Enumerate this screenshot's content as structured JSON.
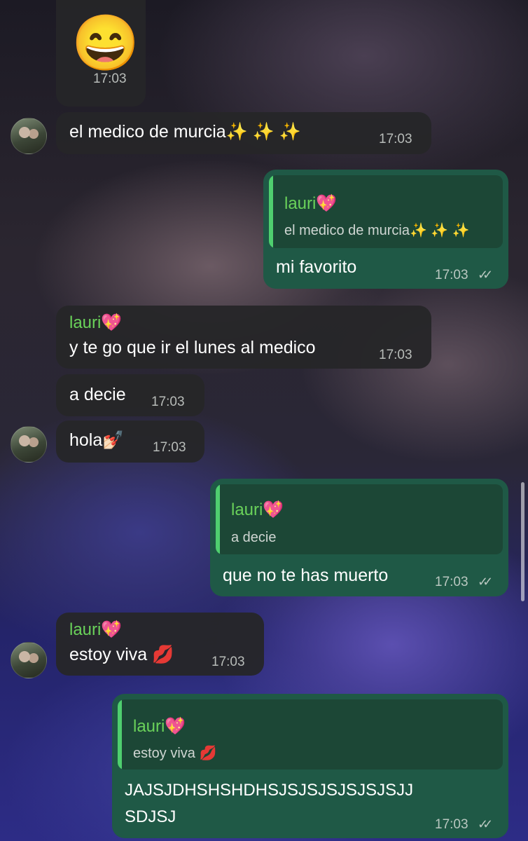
{
  "messages": {
    "m1": {
      "emoji": "😄",
      "time": "17:03"
    },
    "m2": {
      "text": "el medico de murcia✨ ✨ ✨",
      "time": "17:03"
    },
    "m3": {
      "quote_sender": "lauri💖",
      "quote_text": "el medico de murcia✨ ✨ ✨",
      "text": "mi favorito",
      "time": "17:03",
      "ticks": "✓✓"
    },
    "m4": {
      "sender": "lauri💖",
      "text": "y te go que ir el lunes al medico",
      "time": "17:03"
    },
    "m5": {
      "text": "a decie",
      "time": "17:03"
    },
    "m6": {
      "text": "hola💅🏻",
      "time": "17:03"
    },
    "m7": {
      "quote_sender": "lauri💖",
      "quote_text": "a decie",
      "text": "que no te has muerto",
      "time": "17:03",
      "ticks": "✓✓"
    },
    "m8": {
      "sender": "lauri💖",
      "text": "estoy viva 💋",
      "time": "17:03"
    },
    "m9": {
      "quote_sender": "lauri💖",
      "quote_text": "estoy viva 💋",
      "text_line1": "JAJSJDHSHSHDHSJSJSJSJSJSJSJJ",
      "text_line2": "SDJSJ",
      "time": "17:03",
      "ticks": "✓✓"
    }
  },
  "colors": {
    "incoming_bubble": "#262628",
    "outgoing_bubble": "#1f5946",
    "quote_bar": "#4fcf6f",
    "sender_name": "#6ad25a"
  }
}
